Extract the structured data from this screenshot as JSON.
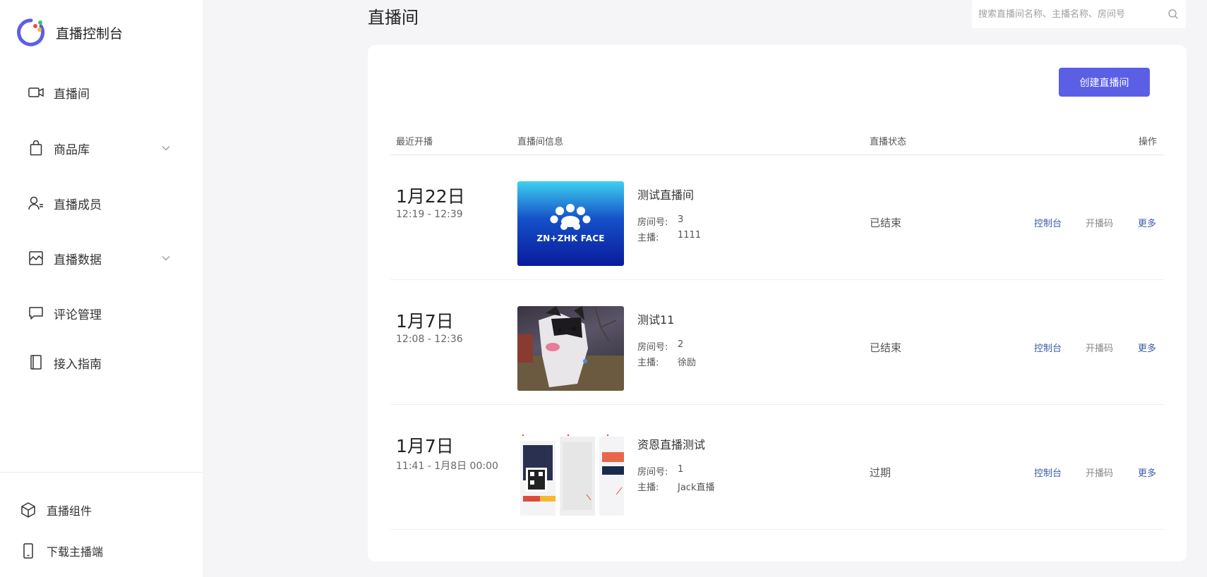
{
  "app": {
    "name": "直播控制台"
  },
  "nav": [
    {
      "label": "直播间",
      "icon": "video-camera-icon"
    },
    {
      "label": "商品库",
      "icon": "shopping-bag-icon",
      "expandable": true
    },
    {
      "label": "直播成员",
      "icon": "members-icon"
    },
    {
      "label": "直播数据",
      "icon": "chart-image-icon",
      "expandable": true
    },
    {
      "label": "评论管理",
      "icon": "comment-icon"
    },
    {
      "label": "接入指南",
      "icon": "book-icon"
    }
  ],
  "bottom_nav": [
    {
      "label": "直播组件",
      "icon": "cube-icon"
    },
    {
      "label": "下载主播端",
      "icon": "phone-icon"
    }
  ],
  "header": {
    "title": "直播间",
    "search_placeholder": "搜索直播间名称、主播名称、房间号"
  },
  "toolbar": {
    "create_label": "创建直播间"
  },
  "table": {
    "columns": [
      "最近开播",
      "直播间信息",
      "直播状态",
      "操作"
    ],
    "room_label": "房间号:",
    "host_label": "主播:",
    "rows": [
      {
        "date": "1月22日",
        "time": "12:19 - 12:39",
        "name": "测试直播间",
        "room": "3",
        "host": "1111",
        "status": "已结束",
        "thumb_text": "ZN+ZHK FACE",
        "actions": [
          "控制台",
          "开播码",
          "更多"
        ]
      },
      {
        "date": "1月7日",
        "time": "12:08 - 12:36",
        "name": "测试11",
        "room": "2",
        "host": "徐励",
        "status": "已结束",
        "actions": [
          "控制台",
          "开播码",
          "更多"
        ]
      },
      {
        "date": "1月7日",
        "time": "11:41 - 1月8日 00:00",
        "name": "资恩直播测试",
        "room": "1",
        "host": "Jack直播",
        "status": "过期",
        "actions": [
          "控制台",
          "开播码",
          "更多"
        ]
      }
    ]
  },
  "colors": {
    "accent": "#5b5fe6",
    "link": "#3b5da8",
    "background": "#f5f5f7"
  }
}
